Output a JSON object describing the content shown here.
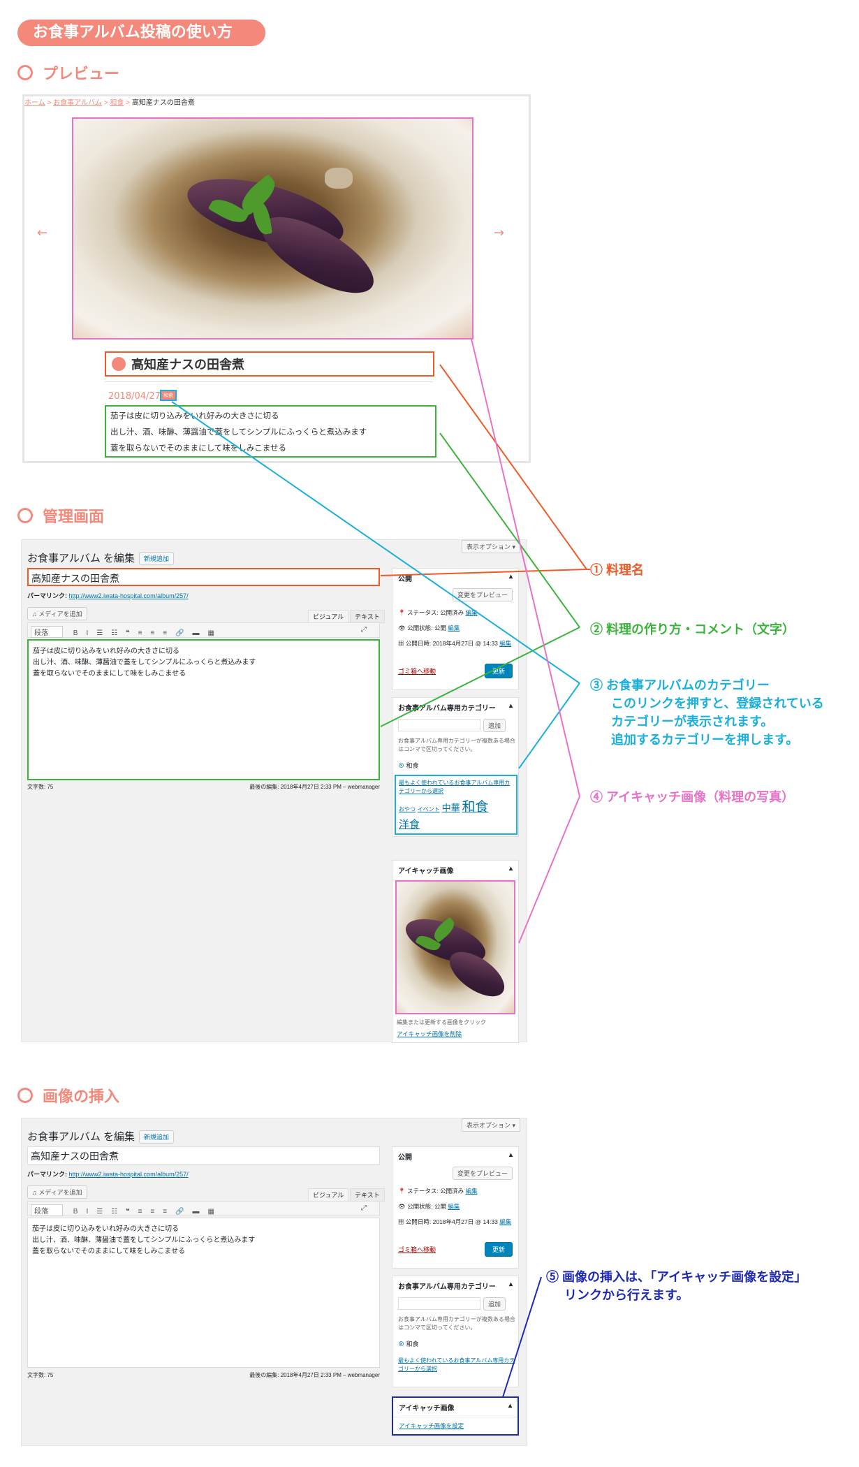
{
  "page_title": "お食事アルバム投稿の使い方",
  "sections": {
    "preview": "プレビュー",
    "admin": "管理画面",
    "insert": "画像の挿入"
  },
  "preview": {
    "breadcrumb": [
      "ホーム",
      "お食事アルバム",
      "和食",
      "高知産ナスの田舎煮"
    ],
    "sep": ">",
    "prev_arrow": "←",
    "next_arrow": "→",
    "title": "高知産ナスの田舎煮",
    "date": "2018/04/27",
    "category_tag": "和食",
    "lines": [
      "茄子は皮に切り込みをいれ好みの大きさに切る",
      "出し汁、酒、味醂、薄醤油で蓋をしてシンプルにふっくらと煮込みます",
      "蓋を取らないでそのままにして味をしみこませる"
    ]
  },
  "editor": {
    "heading": "お食事アルバム を編集",
    "add_new": "新規追加",
    "screen_options": "表示オプション ▾",
    "post_title": "高知産ナスの田舎煮",
    "permalink_label": "パーマリンク:",
    "permalink_url": "http://www2.iwata-hospital.com/album/257/",
    "add_media": "メディアを追加",
    "tab_visual": "ビジュアル",
    "tab_text": "テキスト",
    "format_select": "段落",
    "toolbar": [
      "B",
      "I",
      "☰",
      "☷",
      "❝",
      "≡",
      "≡",
      "≡",
      "🔗",
      "▬",
      "▦"
    ],
    "body_lines": [
      "茄子は皮に切り込みをいれ好みの大きさに切る",
      "出し汁、酒、味醂、薄醤油で蓋をしてシンプルにふっくらと煮込みます",
      "蓋を取らないでそのままにして味をしみこませる"
    ],
    "word_count": "文字数: 75",
    "last_edit": "最後の編集: 2018年4月27日 2:33 PM – webmanager",
    "publish": {
      "title": "公開",
      "preview_btn": "変更をプレビュー",
      "status": "ステータス: 公開済み",
      "visibility": "公開状態: 公開",
      "published": "公開日時: 2018年4月27日 @ 14:33",
      "edit": "編集",
      "trash": "ゴミ箱へ移動",
      "update": "更新"
    },
    "category": {
      "title": "お食事アルバム専用カテゴリー",
      "add_btn": "追加",
      "help": "お食事アルバム専用カテゴリーが複数ある場合はコンマで区切ってください。",
      "current": "和食",
      "most_used": "最もよく使われているお食事アルバム専用カテゴリーから選択",
      "tags": [
        "おやつ",
        "イベント",
        "中華",
        "和食",
        "洋食"
      ]
    },
    "featured": {
      "title": "アイキャッチ画像",
      "hint": "編集または更新する画像をクリック",
      "remove": "アイキャッチ画像を削除",
      "set": "アイキャッチ画像を設定"
    }
  },
  "callouts": {
    "c1": "① 料理名",
    "c2": "② 料理の作り方・コメント（文字）",
    "c3": [
      "③ お食事アルバムのカテゴリー",
      "このリンクを押すと、登録されている",
      "カテゴリーが表示されます。",
      "追加するカテゴリーを押します。"
    ],
    "c4": "④ アイキャッチ画像（料理の写真）",
    "c5": [
      "⑤ 画像の挿入は、「アイキャッチ画像を設定」",
      "リンクから行えます。"
    ]
  },
  "colors": {
    "accent": "#f4897b",
    "orange": "#f05a28",
    "green": "#3cb43c",
    "cyan": "#1ab0dc",
    "pink": "#e673c8",
    "navy": "#1e2ab4"
  }
}
